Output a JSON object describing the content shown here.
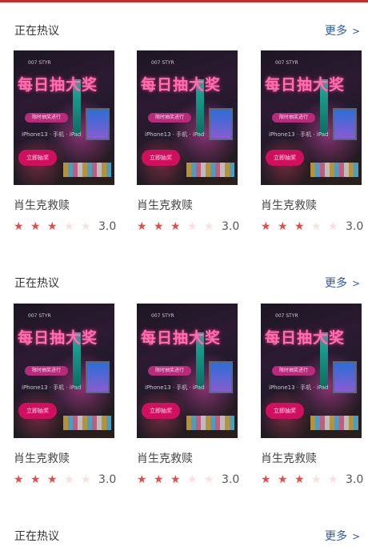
{
  "sections": [
    {
      "title": "正在热议",
      "more_label": "更多",
      "more_chevron": ">",
      "cards": [
        {
          "title": "肖生克救赎",
          "score": "3.0",
          "rating": 3,
          "poster": {
            "small": "007 STYR",
            "big": "每日抽大奖",
            "pill": "限时抽奖进行",
            "sub": "iPhone13 · 手机 · iPad",
            "cta": "立即抽奖"
          }
        },
        {
          "title": "肖生克救赎",
          "score": "3.0",
          "rating": 3,
          "poster": {
            "small": "007 STYR",
            "big": "每日抽大奖",
            "pill": "限时抽奖进行",
            "sub": "iPhone13 · 手机 · iPad",
            "cta": "立即抽奖"
          }
        },
        {
          "title": "肖生克救赎",
          "score": "3.0",
          "rating": 3,
          "poster": {
            "small": "007 STYR",
            "big": "每日抽大奖",
            "pill": "限时抽奖进行",
            "sub": "iPhone13 · 手机 · iPad",
            "cta": "立即抽奖"
          }
        }
      ]
    },
    {
      "title": "正在热议",
      "more_label": "更多",
      "more_chevron": ">",
      "cards": [
        {
          "title": "肖生克救赎",
          "score": "3.0",
          "rating": 3,
          "poster": {
            "small": "007 STYR",
            "big": "每日抽大奖",
            "pill": "限时抽奖进行",
            "sub": "iPhone13 · 手机 · iPad",
            "cta": "立即抽奖"
          }
        },
        {
          "title": "肖生克救赎",
          "score": "3.0",
          "rating": 3,
          "poster": {
            "small": "007 STYR",
            "big": "每日抽大奖",
            "pill": "限时抽奖进行",
            "sub": "iPhone13 · 手机 · iPad",
            "cta": "立即抽奖"
          }
        },
        {
          "title": "肖生克救赎",
          "score": "3.0",
          "rating": 3,
          "poster": {
            "small": "007 STYR",
            "big": "每日抽大奖",
            "pill": "限时抽奖进行",
            "sub": "iPhone13 · 手机 · iPad",
            "cta": "立即抽奖"
          }
        }
      ]
    },
    {
      "title": "正在热议",
      "more_label": "更多",
      "more_chevron": ">"
    }
  ],
  "star_glyph": "★",
  "colors": {
    "accent_bar": "#cc2a2a",
    "star_on": "#e84a4a",
    "star_off": "#fbdede",
    "link": "#2b5aa8"
  }
}
